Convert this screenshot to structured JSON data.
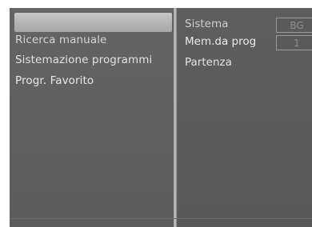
{
  "menu": {
    "items": [
      {
        "label": "Ricerca manuale"
      },
      {
        "label": "Sistemazione programmi"
      },
      {
        "label": "Progr. Favorito"
      }
    ]
  },
  "settings": {
    "sistema_label": "Sistema",
    "sistema_value": "BG",
    "mem_label": "Mem.da prog",
    "mem_value": "1",
    "partenza_label": "Partenza"
  }
}
